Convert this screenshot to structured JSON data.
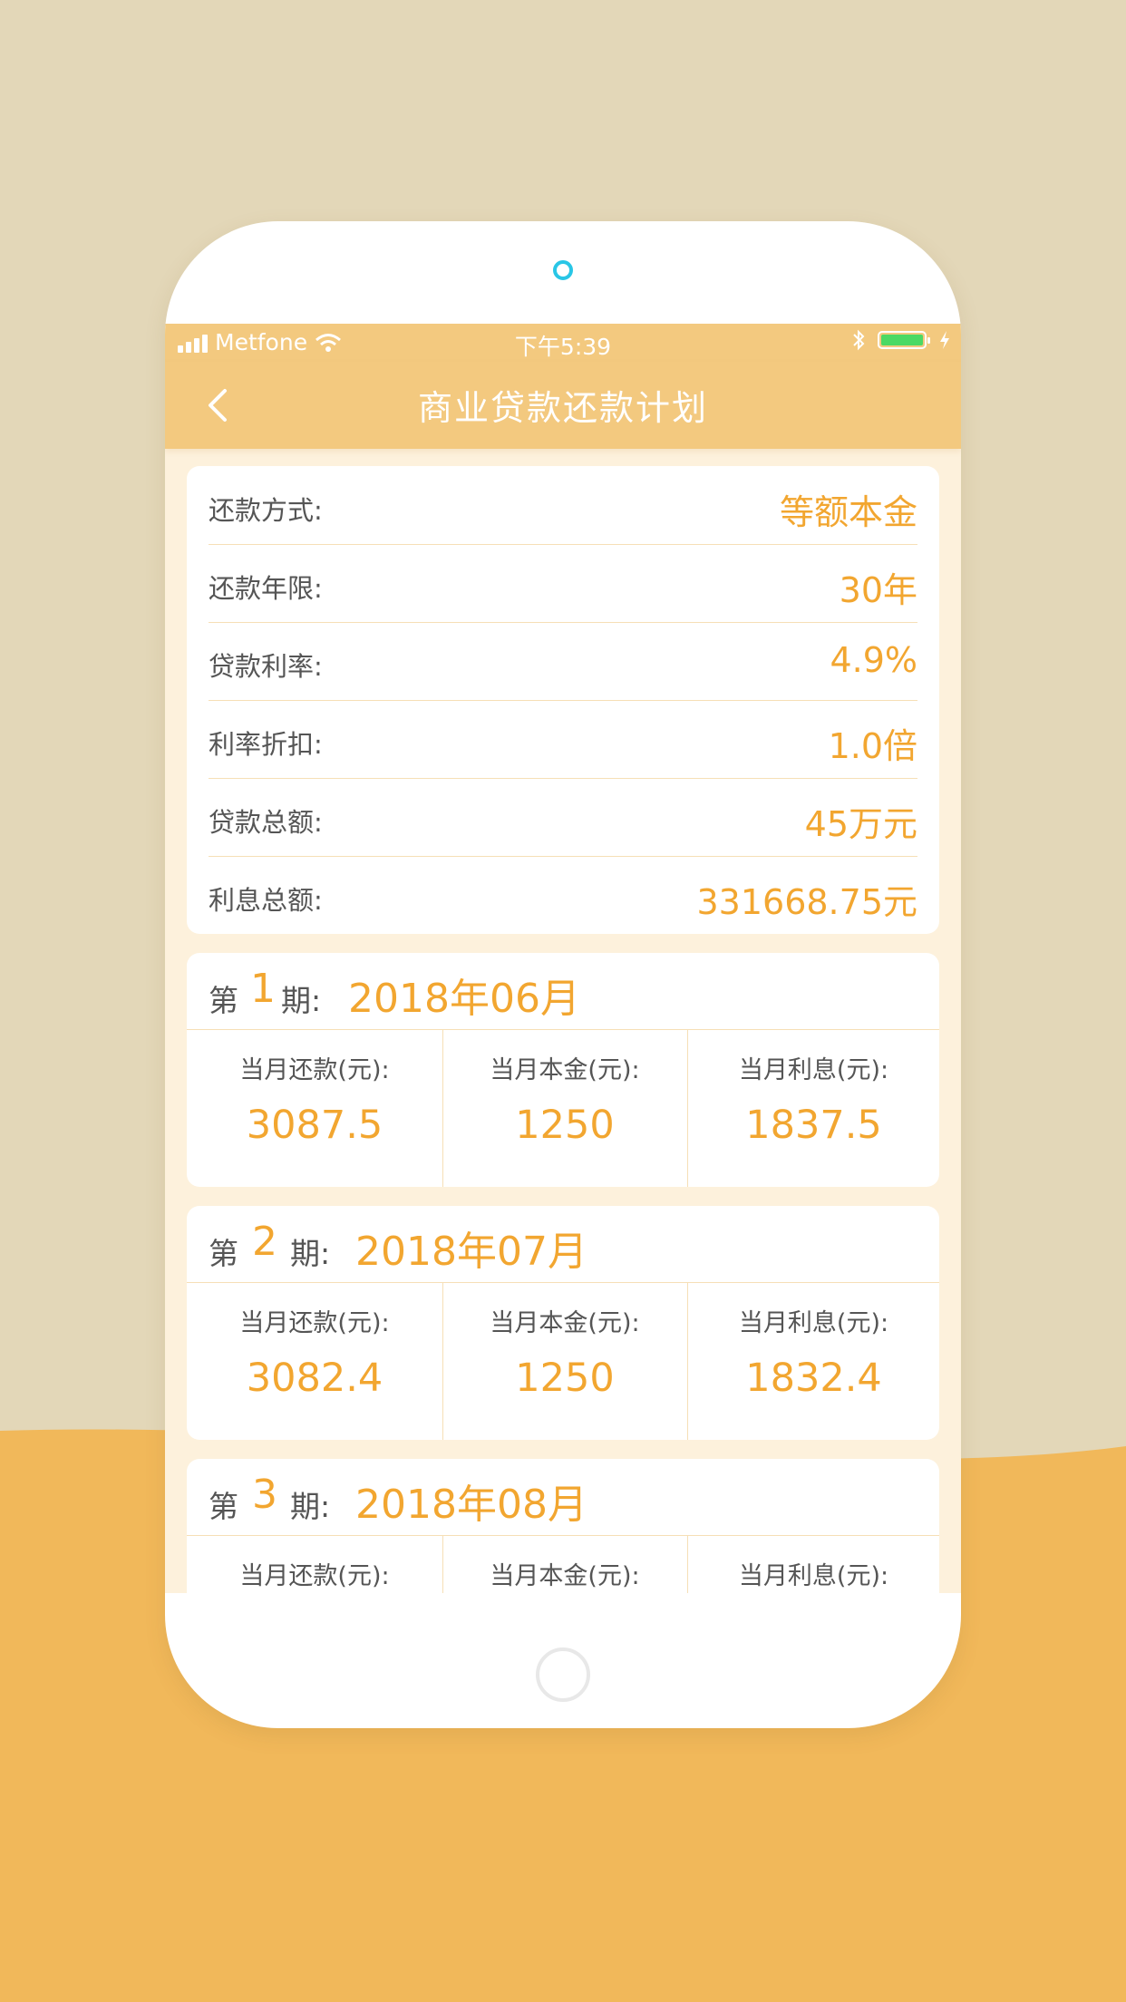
{
  "colors": {
    "accent": "#f2a630",
    "nav": "#f3c97f",
    "background_top": "#e3d7b8",
    "background_bottom": "#f1b85a"
  },
  "status_bar": {
    "carrier": "Metfone",
    "time": "下午5:39"
  },
  "nav": {
    "title": "商业贷款还款计划",
    "back_icon": "chevron-left-icon"
  },
  "summary": [
    {
      "label": "还款方式:",
      "value": "等额本金"
    },
    {
      "label": "还款年限:",
      "value": "30年"
    },
    {
      "label": "贷款利率:",
      "value": "4.9%"
    },
    {
      "label": "利率折扣:",
      "value": "1.0倍"
    },
    {
      "label": "贷款总额:",
      "value": "45万元"
    },
    {
      "label": "利息总额:",
      "value": "331668.75元"
    }
  ],
  "period_labels": {
    "prefix": "第",
    "suffix": "期:"
  },
  "column_labels": {
    "payment": "当月还款(元):",
    "principal": "当月本金(元):",
    "interest": "当月利息(元):"
  },
  "periods": [
    {
      "num": "1",
      "date": "2018年06月",
      "payment": "3087.5",
      "principal": "1250",
      "interest": "1837.5"
    },
    {
      "num": "2",
      "date": "2018年07月",
      "payment": "3082.4",
      "principal": "1250",
      "interest": "1832.4"
    },
    {
      "num": "3",
      "date": "2018年08月",
      "payment": "",
      "principal": "",
      "interest": ""
    }
  ]
}
